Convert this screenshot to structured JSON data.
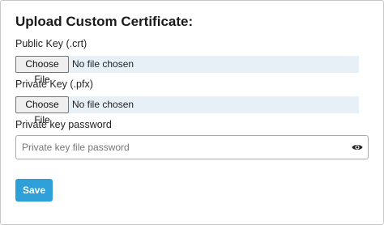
{
  "form": {
    "title": "Upload Custom Certificate:",
    "public_key": {
      "label": "Public Key (.crt)",
      "button_label": "Choose File",
      "status": "No file chosen"
    },
    "private_key": {
      "label": "Private Key (.pfx)",
      "button_label": "Choose File",
      "status": "No file chosen"
    },
    "password": {
      "label": "Private key password",
      "placeholder": "Private key file password",
      "value": "",
      "toggle_icon": "eye-icon"
    },
    "save_label": "Save"
  },
  "colors": {
    "accent": "#2f9fd8",
    "file_row_bg": "#e8f0f7",
    "border": "#aaaaaa"
  }
}
